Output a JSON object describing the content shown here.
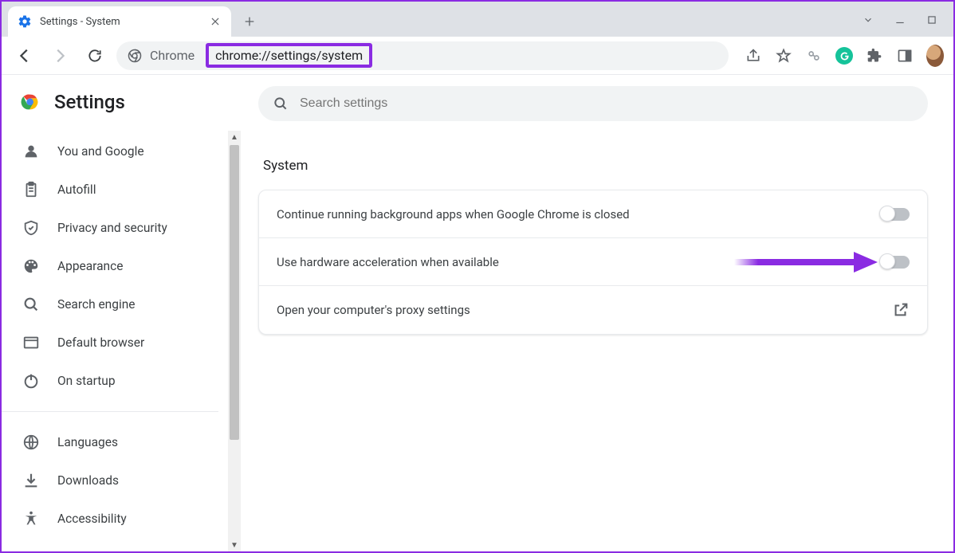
{
  "window": {
    "tab_title": "Settings - System"
  },
  "toolbar": {
    "omnibox_label": "Chrome",
    "url": "chrome://settings/system"
  },
  "sidebar": {
    "title": "Settings",
    "items": [
      {
        "id": "you-and-google",
        "label": "You and Google",
        "icon": "person"
      },
      {
        "id": "autofill",
        "label": "Autofill",
        "icon": "clipboard"
      },
      {
        "id": "privacy",
        "label": "Privacy and security",
        "icon": "shield"
      },
      {
        "id": "appearance",
        "label": "Appearance",
        "icon": "palette"
      },
      {
        "id": "search-engine",
        "label": "Search engine",
        "icon": "search"
      },
      {
        "id": "default-browser",
        "label": "Default browser",
        "icon": "browser"
      },
      {
        "id": "on-startup",
        "label": "On startup",
        "icon": "power"
      }
    ],
    "items2": [
      {
        "id": "languages",
        "label": "Languages",
        "icon": "globe"
      },
      {
        "id": "downloads",
        "label": "Downloads",
        "icon": "download"
      },
      {
        "id": "accessibility",
        "label": "Accessibility",
        "icon": "accessibility"
      }
    ]
  },
  "main": {
    "search_placeholder": "Search settings",
    "section_title": "System",
    "rows": [
      {
        "label": "Continue running background apps when Google Chrome is closed",
        "type": "toggle",
        "value": false
      },
      {
        "label": "Use hardware acceleration when available",
        "type": "toggle",
        "value": false
      },
      {
        "label": "Open your computer's proxy settings",
        "type": "link"
      }
    ]
  },
  "annotation": {
    "highlight_url": true,
    "arrow_row_index": 1,
    "arrow_color": "#8a2be2"
  }
}
